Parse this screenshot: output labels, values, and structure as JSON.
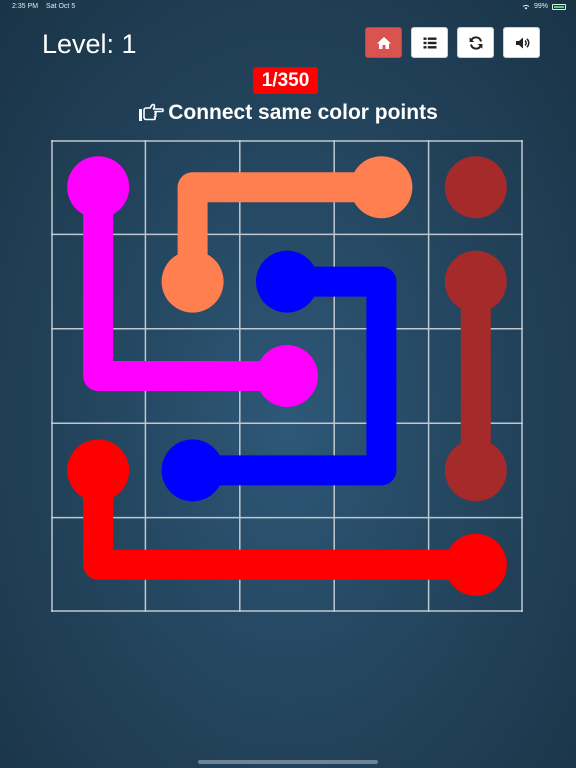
{
  "status_bar": {
    "time": "2:35 PM",
    "date": "Sat Oct 5",
    "battery": "99%"
  },
  "header": {
    "level_label": "Level: 1"
  },
  "toolbar": {
    "buttons": [
      {
        "name": "home",
        "icon": "home-icon",
        "active": true
      },
      {
        "name": "levels",
        "icon": "list-icon",
        "active": false
      },
      {
        "name": "restart",
        "icon": "refresh-icon",
        "active": false
      },
      {
        "name": "sound",
        "icon": "speaker-icon",
        "active": false
      }
    ],
    "active_color": "#d9534f"
  },
  "progress": {
    "text": "1/350",
    "color": "#ff0000"
  },
  "instruction": {
    "icon": "pointing-hand-icon",
    "text": "Connect same color points"
  },
  "board": {
    "rows": 5,
    "cols": 5,
    "grid_color": "#bfc8d0",
    "flows": [
      {
        "color_name": "magenta",
        "color": "#ff00ff",
        "path": [
          [
            0,
            0
          ],
          [
            1,
            0
          ],
          [
            2,
            0
          ],
          [
            2,
            1
          ],
          [
            2,
            2
          ]
        ]
      },
      {
        "color_name": "orange",
        "color": "#ff7f50",
        "path": [
          [
            0,
            3
          ],
          [
            0,
            2
          ],
          [
            0,
            1
          ],
          [
            1,
            1
          ]
        ]
      },
      {
        "color_name": "blue",
        "color": "#0000ff",
        "path": [
          [
            1,
            2
          ],
          [
            1,
            3
          ],
          [
            2,
            3
          ],
          [
            3,
            3
          ],
          [
            3,
            2
          ],
          [
            3,
            1
          ]
        ]
      },
      {
        "color_name": "dark-red",
        "color": "#a52a2a",
        "path": [
          [
            1,
            4
          ],
          [
            2,
            4
          ],
          [
            3,
            4
          ]
        ],
        "extra_endpoints": [
          [
            0,
            4
          ]
        ]
      },
      {
        "color_name": "red",
        "color": "#ff0000",
        "path": [
          [
            3,
            0
          ],
          [
            4,
            0
          ],
          [
            4,
            1
          ],
          [
            4,
            2
          ],
          [
            4,
            3
          ],
          [
            4,
            4
          ]
        ]
      }
    ]
  }
}
